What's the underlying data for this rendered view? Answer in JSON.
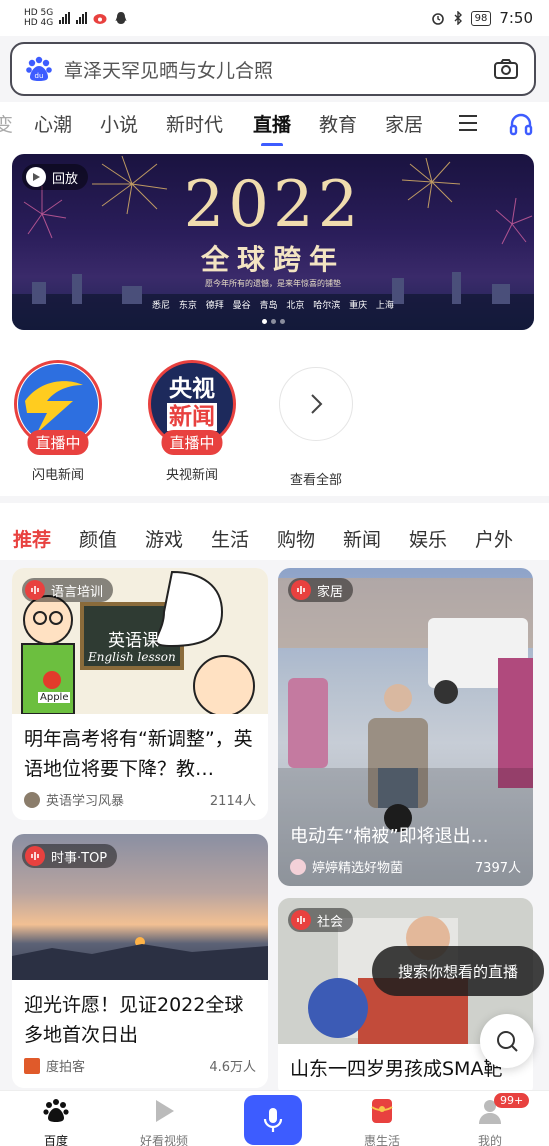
{
  "status_bar": {
    "left_labels": [
      "HD 5G",
      "HD 4G"
    ],
    "battery": "98",
    "time": "7:50"
  },
  "search": {
    "query": "章泽天罕见晒与女儿合照"
  },
  "channel_tabs": {
    "items": [
      {
        "label": "变",
        "active": false
      },
      {
        "label": "心潮",
        "active": false
      },
      {
        "label": "小说",
        "active": false
      },
      {
        "label": "新时代",
        "active": false
      },
      {
        "label": "直播",
        "active": true
      },
      {
        "label": "教育",
        "active": false
      },
      {
        "label": "家居",
        "active": false
      }
    ]
  },
  "banner": {
    "badge": "回放",
    "year": "2022",
    "title": "全球跨年",
    "subtitle": "愿今年所有的遗憾，是来年惊喜的铺垫",
    "cities": "悉尼 东京 德拜 曼谷 青岛 北京 哈尔滨 重庆 上海"
  },
  "live_channels": [
    {
      "name": "闪电新闻",
      "onair": "直播中"
    },
    {
      "name": "央视新闻",
      "onair": "直播中",
      "logo_text": [
        "央视",
        "新闻"
      ]
    },
    {
      "name": "查看全部"
    }
  ],
  "categories": {
    "items": [
      {
        "label": "推荐",
        "active": true
      },
      {
        "label": "颜值",
        "active": false
      },
      {
        "label": "游戏",
        "active": false
      },
      {
        "label": "生活",
        "active": false
      },
      {
        "label": "购物",
        "active": false
      },
      {
        "label": "新闻",
        "active": false
      },
      {
        "label": "娱乐",
        "active": false
      },
      {
        "label": "户外",
        "active": false
      }
    ]
  },
  "feed": {
    "card1": {
      "tag": "语言培训",
      "img_board": "英语课",
      "img_board2": "English lesson",
      "img_apple": "Apple",
      "title": "明年高考将有“新调整”，英语地位将要下降？教…",
      "author": "英语学习风暴",
      "count": "2114人"
    },
    "card2": {
      "tag": "家居",
      "title": "电动车“棉被”即将退出…",
      "author": "婷婷精选好物菌",
      "count": "7397人"
    },
    "card3": {
      "tag": "时事·TOP",
      "title": "迎光许愿！见证2022全球多地首次日出",
      "author": "度拍客",
      "count": "4.6万人"
    },
    "card4": {
      "tag": "社会",
      "title": "山东一四岁男孩成SMA靶"
    }
  },
  "tooltip": "搜索你想看的直播",
  "bottom_nav": {
    "items": [
      {
        "label": "百度",
        "active": true
      },
      {
        "label": "好看视频",
        "active": false
      },
      {
        "label": "惠生活",
        "active": false
      },
      {
        "label": "我的",
        "active": false
      }
    ],
    "badge": "99+"
  },
  "colors": {
    "accent": "#3d5cff",
    "live_red": "#e8413f"
  }
}
